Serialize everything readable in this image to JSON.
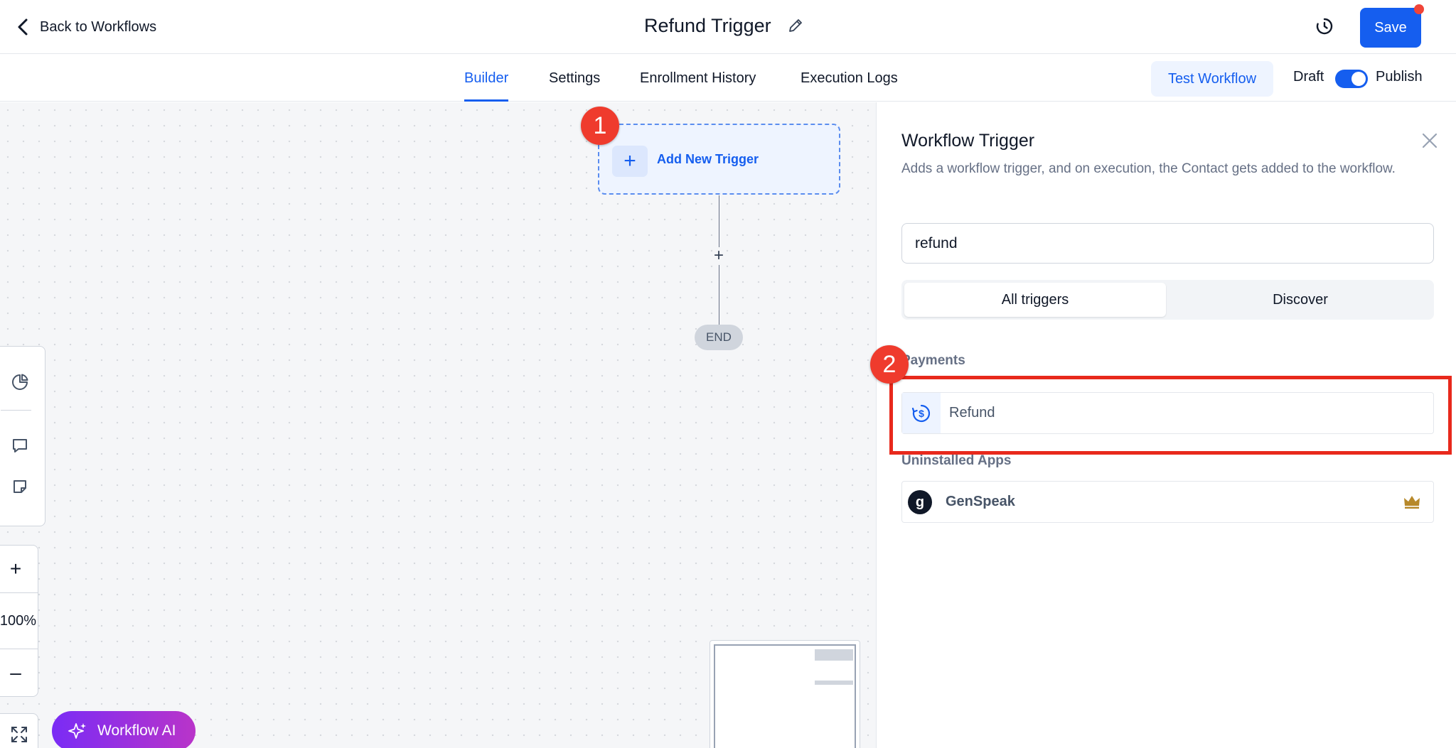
{
  "header": {
    "back_label": "Back to Workflows",
    "title": "Refund Trigger",
    "save_label": "Save"
  },
  "tabs": [
    {
      "label": "Builder",
      "active": true
    },
    {
      "label": "Settings",
      "active": false
    },
    {
      "label": "Enrollment History",
      "active": false
    },
    {
      "label": "Execution Logs",
      "active": false
    }
  ],
  "nav_actions": {
    "test_workflow_label": "Test Workflow",
    "draft_label": "Draft",
    "publish_label": "Publish",
    "published": true
  },
  "canvas": {
    "trigger_node_label": "Add New Trigger",
    "end_label": "END",
    "zoom_level": "100%",
    "ai_button_label": "Workflow AI",
    "callouts": [
      "1",
      "2"
    ]
  },
  "panel": {
    "title": "Workflow Trigger",
    "description": "Adds a workflow trigger, and on execution, the Contact gets added to the workflow.",
    "search_value": "refund",
    "segments": [
      {
        "label": "All triggers",
        "active": true
      },
      {
        "label": "Discover",
        "active": false
      }
    ],
    "categories": [
      {
        "label": "Payments",
        "items": [
          {
            "label": "Refund",
            "icon": "refund-dollar-icon"
          }
        ]
      },
      {
        "label": "Uninstalled Apps",
        "items": [
          {
            "label": "GenSpeak",
            "icon": "genspeak-logo",
            "logo_letter": "g",
            "premium": true
          }
        ]
      }
    ]
  },
  "colors": {
    "primary": "#155eef",
    "callout_red": "#ef3b2d",
    "highlight_red": "#e8291c",
    "ai_gradient_start": "#7a2cf5",
    "ai_gradient_end": "#b934c9",
    "crown_gold": "#b7892b"
  }
}
